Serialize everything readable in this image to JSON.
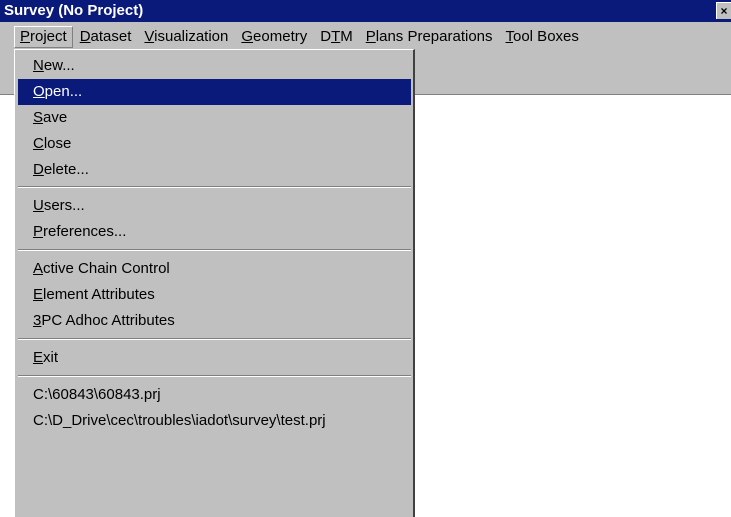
{
  "window": {
    "title": "Survey (No Project)",
    "close_glyph": "×"
  },
  "menubar": {
    "items": [
      {
        "pre": "",
        "key": "P",
        "post": "roject"
      },
      {
        "pre": "",
        "key": "D",
        "post": "ataset"
      },
      {
        "pre": "",
        "key": "V",
        "post": "isualization"
      },
      {
        "pre": "",
        "key": "G",
        "post": "eometry"
      },
      {
        "pre": "D",
        "key": "T",
        "post": "M"
      },
      {
        "pre": "",
        "key": "P",
        "post": "lans Preparations"
      },
      {
        "pre": "",
        "key": "T",
        "post": "ool Boxes"
      }
    ]
  },
  "project_menu": {
    "items": [
      {
        "pre": "",
        "key": "N",
        "post": "ew..."
      },
      {
        "pre": "",
        "key": "O",
        "post": "pen..."
      },
      {
        "pre": "",
        "key": "S",
        "post": "ave"
      },
      {
        "pre": "",
        "key": "C",
        "post": "lose"
      },
      {
        "pre": "",
        "key": "D",
        "post": "elete..."
      },
      {
        "pre": "",
        "key": "U",
        "post": "sers..."
      },
      {
        "pre": "",
        "key": "P",
        "post": "references..."
      },
      {
        "pre": "",
        "key": "A",
        "post": "ctive Chain Control"
      },
      {
        "pre": "",
        "key": "E",
        "post": "lement Attributes"
      },
      {
        "pre": "",
        "key": "3",
        "post": "PC Adhoc Attributes"
      },
      {
        "pre": "",
        "key": "E",
        "post": "xit"
      },
      {
        "pre": "",
        "key": "",
        "post": "C:\\60843\\60843.prj"
      },
      {
        "pre": "",
        "key": "",
        "post": "C:\\D_Drive\\cec\\troubles\\iadot\\survey\\test.prj"
      }
    ],
    "highlighted_index": 1
  },
  "colors": {
    "titlebar": "#0a1a7a",
    "highlight": "#0a1a7a",
    "face": "#c0c0c0"
  }
}
